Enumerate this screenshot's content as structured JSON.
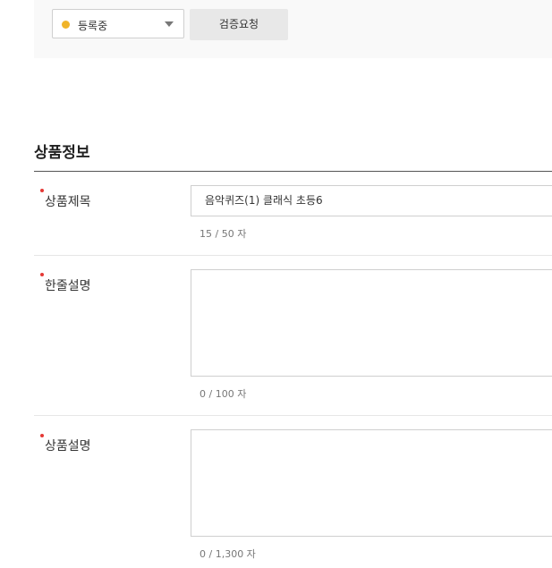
{
  "status": {
    "selected": "등록중",
    "dot_color": "#f0b429",
    "verify_button": "검증요청"
  },
  "section_title": "상품정보",
  "fields": {
    "title": {
      "label": "상품제목",
      "value": "음악퀴즈(1) 클래식 초등6",
      "counter": "15 / 50 자"
    },
    "summary": {
      "label": "한줄설명",
      "value": "",
      "counter": "0 / 100 자"
    },
    "description": {
      "label": "상품설명",
      "value": "",
      "counter": "0 / 1,300 자"
    }
  }
}
